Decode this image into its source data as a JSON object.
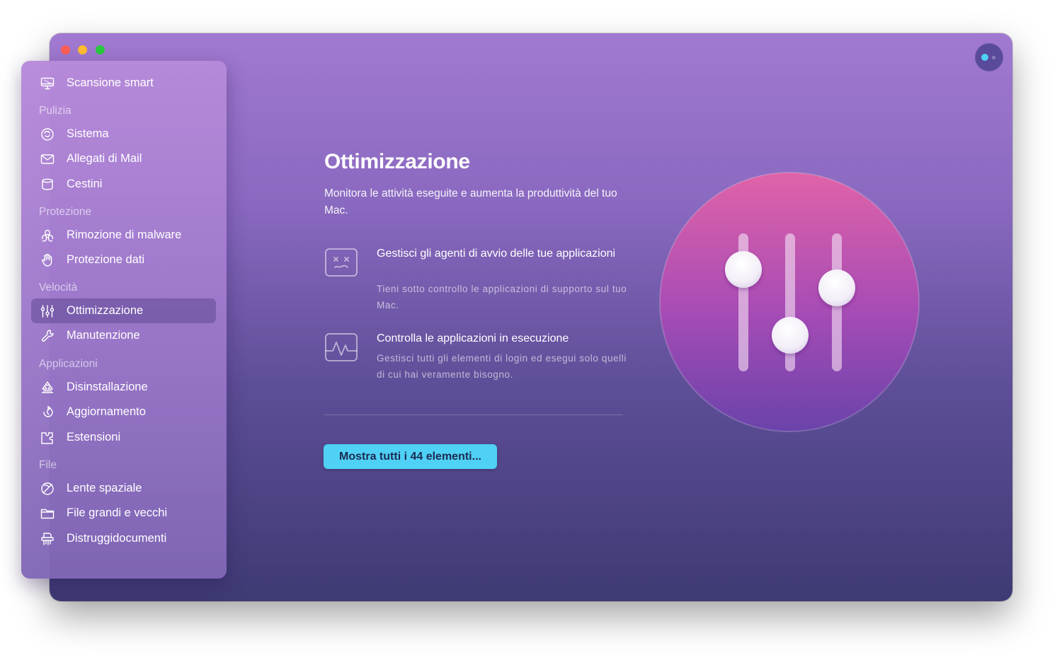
{
  "window": {
    "controls": [
      "close",
      "minimize",
      "zoom"
    ],
    "assistant_icon": "assistant-icon"
  },
  "sidebar": {
    "top_item": {
      "label": "Scansione smart",
      "icon": "monitor-icon"
    },
    "sections": [
      {
        "title": "Pulizia",
        "items": [
          {
            "label": "Sistema",
            "icon": "system-junk-icon"
          },
          {
            "label": "Allegati di Mail",
            "icon": "mail-icon"
          },
          {
            "label": "Cestini",
            "icon": "trash-bin-icon"
          }
        ]
      },
      {
        "title": "Protezione",
        "items": [
          {
            "label": "Rimozione di malware",
            "icon": "biohazard-icon"
          },
          {
            "label": "Protezione dati",
            "icon": "hand-icon"
          }
        ]
      },
      {
        "title": "Velocità",
        "items": [
          {
            "label": "Ottimizzazione",
            "icon": "sliders-icon",
            "active": true
          },
          {
            "label": "Manutenzione",
            "icon": "wrench-icon"
          }
        ]
      },
      {
        "title": "Applicazioni",
        "items": [
          {
            "label": "Disinstallazione",
            "icon": "uninstaller-icon"
          },
          {
            "label": "Aggiornamento",
            "icon": "updater-icon"
          },
          {
            "label": "Estensioni",
            "icon": "extensions-icon"
          }
        ]
      },
      {
        "title": "File",
        "items": [
          {
            "label": "Lente spaziale",
            "icon": "space-lens-icon"
          },
          {
            "label": "File grandi e vecchi",
            "icon": "folder-icon"
          },
          {
            "label": "Distruggidocumenti",
            "icon": "shredder-icon"
          }
        ]
      }
    ]
  },
  "main": {
    "title": "Ottimizzazione",
    "description": "Monitora le attività eseguite e aumenta la produttività del tuo Mac.",
    "features": [
      {
        "icon": "launch-agents-icon",
        "title": "Gestisci gli agenti di avvio delle tue applicazioni",
        "description": "Tieni sotto controllo le applicazioni di supporto sul tuo Mac."
      },
      {
        "icon": "activity-monitor-icon",
        "title": "Controlla le applicazioni in esecuzione",
        "description": "Gestisci tutti gli elementi di login ed esegui solo quelli di cui hai veramente bisogno."
      }
    ],
    "button_label": "Mostra tutti i 44 elementi...",
    "hero_icon": "optimization-sliders-icon"
  },
  "colors": {
    "accent": "#4fd1f5",
    "close": "#fe5f57",
    "minimize": "#febc2e",
    "zoom": "#28c840"
  }
}
